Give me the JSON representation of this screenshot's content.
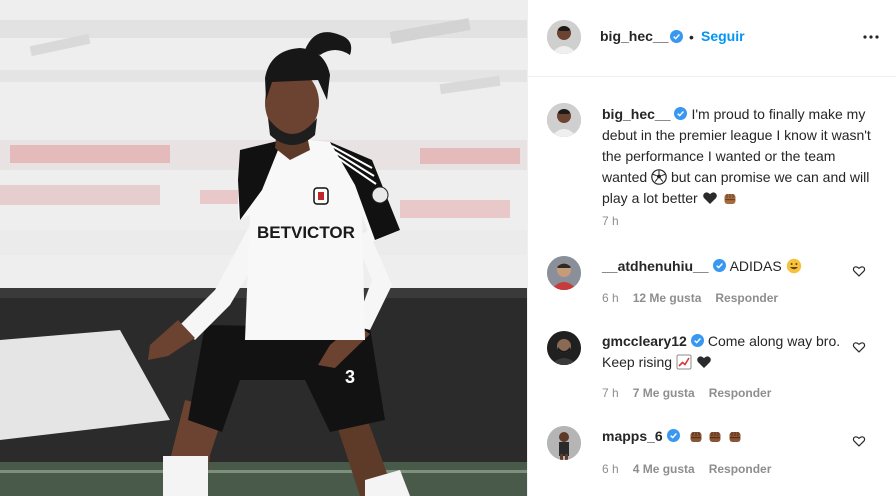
{
  "post": {
    "username": "big_hec__",
    "follow_label": "Seguir",
    "separator": "•"
  },
  "caption": {
    "username": "big_hec__",
    "text_1": "I'm proud to finally make my debut in the premier league I know it wasn't the performance I wanted or the team wanted",
    "text_2": "but can promise we can and will play a lot better",
    "time": "7 h"
  },
  "comments": [
    {
      "username": "__atdhenuhiu__",
      "text": "ADIDAS",
      "time": "6 h",
      "likes": "12 Me gusta",
      "reply": "Responder"
    },
    {
      "username": "gmccleary12",
      "text": "Come along way bro. Keep rising",
      "time": "7 h",
      "likes": "7 Me gusta",
      "reply": "Responder"
    },
    {
      "username": "mapps_6",
      "text": "",
      "time": "6 h",
      "likes": "4 Me gusta",
      "reply": "Responder"
    }
  ],
  "photo": {
    "shirt_sponsor": "BETVICTOR",
    "shorts_number": "3"
  },
  "colors": {
    "link_blue": "#0095f6",
    "verified_blue": "#3897f0",
    "muted_text": "#8e8e8e",
    "divider": "#efefef"
  },
  "icons": [
    "verified-icon",
    "more-options-icon",
    "heart-icon",
    "soccer-ball-emoji",
    "black-heart-emoji",
    "fist-emoji",
    "grinning-emoji",
    "chart-increasing-emoji"
  ]
}
